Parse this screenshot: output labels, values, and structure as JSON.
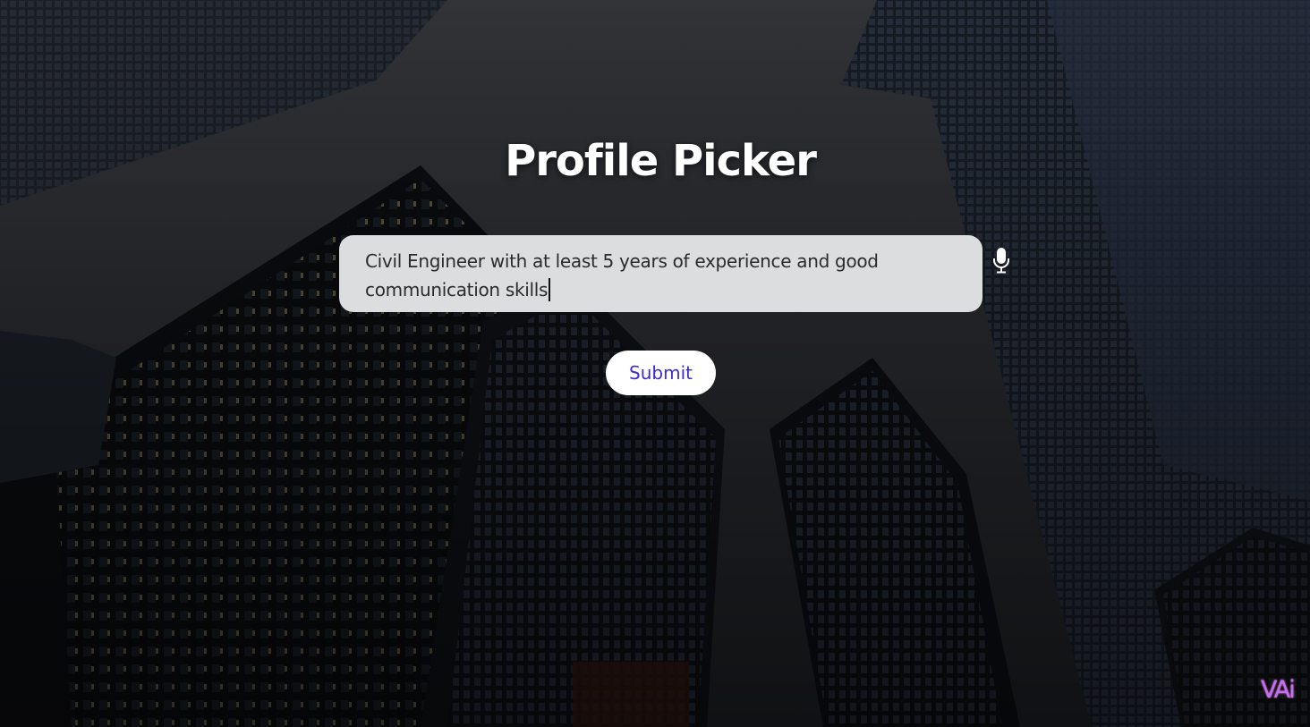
{
  "page": {
    "title": "Profile Picker"
  },
  "query": {
    "value": "Civil Engineer with at least 5 years of experience and good communication skills"
  },
  "actions": {
    "submit_label": "Submit",
    "mic_icon": "microphone-icon"
  },
  "brand": {
    "logo_text": "VAi"
  },
  "colors": {
    "title_text": "#ffffff",
    "input_background": "#dcdddf",
    "submit_text": "#3a2bd6",
    "submit_background": "#ffffff"
  }
}
